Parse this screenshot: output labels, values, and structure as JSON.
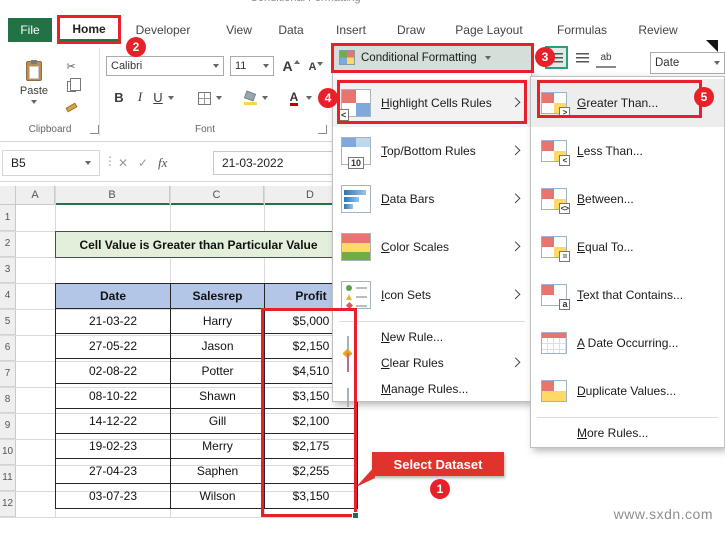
{
  "window": {
    "title_partial": "Conditional Formatting",
    "watermark": "www.sxdn.com"
  },
  "ribbon": {
    "tabs": [
      {
        "label": "File"
      },
      {
        "label": "Home"
      },
      {
        "label": "Developer"
      },
      {
        "label": "View"
      },
      {
        "label": "Data"
      },
      {
        "label": "Insert"
      },
      {
        "label": "Draw"
      },
      {
        "label": "Page Layout"
      },
      {
        "label": "Formulas"
      },
      {
        "label": "Review"
      }
    ],
    "clipboard": {
      "paste_label": "Paste",
      "group_label": "Clipboard"
    },
    "font_group": {
      "font_name": "Calibri",
      "font_size": "11",
      "grow_font": "A",
      "shrink_font": "A",
      "bold": "B",
      "italic": "I",
      "underline": "U",
      "font_color": "A",
      "group_label": "Font"
    },
    "cf_button_label": "Conditional Formatting",
    "wrap_icon_label": "ab",
    "number_format_value": "Date"
  },
  "formula_bar": {
    "name_box": "B5",
    "fx_label": "fx",
    "value": "21-03-2022"
  },
  "sheet": {
    "col_headers": [
      "A",
      "B",
      "C",
      "D"
    ],
    "row_headers": [
      "1",
      "2",
      "3",
      "4",
      "5",
      "6",
      "7",
      "8",
      "9",
      "10",
      "11",
      "12"
    ],
    "title_cell": "Cell Value is Greater than Particular Value",
    "table": {
      "headers": [
        "Date",
        "Salesrep",
        "Profit"
      ],
      "rows": [
        [
          "21-03-22",
          "Harry",
          "$5,000"
        ],
        [
          "27-05-22",
          "Jason",
          "$2,150"
        ],
        [
          "02-08-22",
          "Potter",
          "$4,510"
        ],
        [
          "08-10-22",
          "Shawn",
          "$3,150"
        ],
        [
          "14-12-22",
          "Gill",
          "$2,100"
        ],
        [
          "19-02-23",
          "Merry",
          "$2,175"
        ],
        [
          "27-04-23",
          "Saphen",
          "$2,255"
        ],
        [
          "03-07-23",
          "Wilson",
          "$3,150"
        ]
      ]
    }
  },
  "cf_menu": {
    "items": [
      {
        "label": "Highlight Cells Rules",
        "icon": "highlight-cells-rules-icon",
        "badge": "<",
        "has_submenu": true
      },
      {
        "label": "Top/Bottom Rules",
        "icon": "top-bottom-rules-icon",
        "badge": "10",
        "has_submenu": true
      },
      {
        "label": "Data Bars",
        "icon": "data-bars-icon",
        "has_submenu": true
      },
      {
        "label": "Color Scales",
        "icon": "color-scales-icon",
        "has_submenu": true
      },
      {
        "label": "Icon Sets",
        "icon": "icon-sets-icon",
        "has_submenu": true
      },
      {
        "label": "New Rule...",
        "icon": "new-rule-icon",
        "has_submenu": false
      },
      {
        "label": "Clear Rules",
        "icon": "clear-rules-icon",
        "has_submenu": true
      },
      {
        "label": "Manage Rules...",
        "icon": "manage-rules-icon",
        "has_submenu": false
      }
    ]
  },
  "cf_submenu": {
    "items": [
      {
        "label": "Greater Than...",
        "icon": "greater-than-icon",
        "badge": ">"
      },
      {
        "label": "Less Than...",
        "icon": "less-than-icon",
        "badge": "<"
      },
      {
        "label": "Between...",
        "icon": "between-icon",
        "badge": "<>"
      },
      {
        "label": "Equal To...",
        "icon": "equal-to-icon",
        "badge": "="
      },
      {
        "label": "Text that Contains...",
        "icon": "text-contains-icon",
        "badge": "a"
      },
      {
        "label": "A Date Occurring...",
        "icon": "date-occurring-icon"
      },
      {
        "label": "Duplicate Values...",
        "icon": "duplicate-values-icon"
      },
      {
        "label": "More Rules...",
        "icon": "none"
      }
    ]
  },
  "annotations": {
    "select_dataset_label": "Select Dataset",
    "steps": [
      "1",
      "2",
      "3",
      "4",
      "5"
    ]
  },
  "colors": {
    "excel_green": "#217346",
    "annotation_red": "#E8202A",
    "title_cell_bg": "#E2EFDA",
    "table_header_bg": "#B4C6E7"
  }
}
